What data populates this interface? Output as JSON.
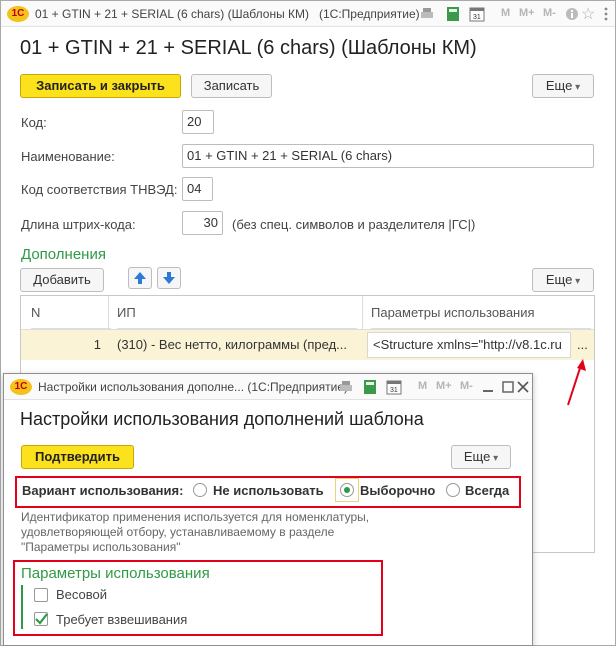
{
  "main_window": {
    "title": "01 + GTIN + 21 + SERIAL (6 chars) (Шаблоны КМ)",
    "app": "(1С:Предприятие)",
    "toolbar_letters": [
      "M",
      "M+",
      "M-"
    ],
    "form_title": "01 + GTIN + 21 + SERIAL (6 chars) (Шаблоны КМ)",
    "buttons": {
      "save_close": "Записать и закрыть",
      "save": "Записать",
      "more": "Еще"
    },
    "fields": {
      "code_label": "Код:",
      "code_value": "20",
      "name_label": "Наименование:",
      "name_value": "01 + GTIN + 21 + SERIAL (6 chars)",
      "tnved_label": "Код соответствия ТНВЭД:",
      "tnved_value": "04",
      "length_label": "Длина штрих-кода:",
      "length_value": "30",
      "length_hint": "(без спец. символов и разделителя |ГС|)"
    },
    "additions": {
      "title": "Дополнения",
      "add_button": "Добавить",
      "more": "Еще",
      "columns": [
        "N",
        "ИП",
        "Параметры использования"
      ],
      "rows": [
        {
          "n": "1",
          "ip": "(310) - Вес нетто, килограммы (пред...",
          "params": "<Structure xmlns=\"http://v8.1c.ru"
        }
      ],
      "ellipsis": "..."
    }
  },
  "dialog": {
    "title": "Настройки использования дополне... (1С:Предприятие)",
    "toolbar_letters": [
      "M",
      "M+",
      "M-"
    ],
    "form_title": "Настройки использования дополнений шаблона",
    "confirm": "Подтвердить",
    "more": "Еще",
    "variant_label": "Вариант использования:",
    "options": [
      "Не использовать",
      "Выборочно",
      "Всегда"
    ],
    "selected_option": "Выборочно",
    "description": [
      "Идентификатор применения используется для номенклатуры,",
      "удовлетворяющей отбору, устанавливаемому в разделе",
      "\"Параметры использования\""
    ],
    "params_title": "Параметры использования",
    "checkboxes": [
      {
        "label": "Весовой",
        "checked": false
      },
      {
        "label": "Требует взвешивания",
        "checked": true
      }
    ]
  },
  "colors": {
    "accent_yellow": "#fce21d",
    "green": "#2e9a47",
    "highlight_red": "#e2001a",
    "row_highlight": "#fbf3d6"
  }
}
